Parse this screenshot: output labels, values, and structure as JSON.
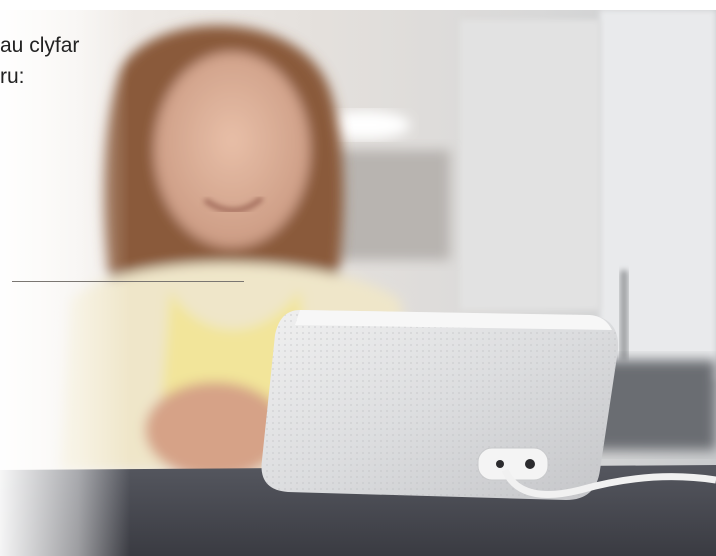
{
  "caption": {
    "line1": "au clyfar",
    "line2": "ru:"
  },
  "colors": {
    "background": "#ffffff",
    "caption_text": "#222222",
    "table_top": "#4a4c55",
    "speaker_fabric": "#d9dadb",
    "hair": "#8a5a3a",
    "cabinet_white": "#e8e9ea"
  }
}
